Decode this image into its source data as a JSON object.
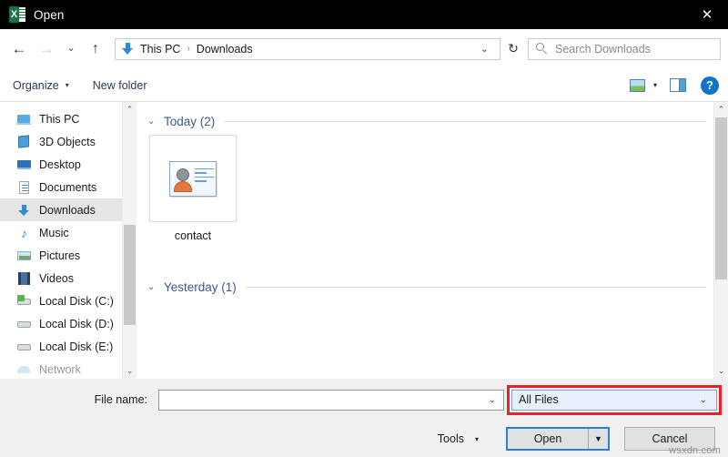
{
  "titlebar": {
    "app_icon": "excel-icon",
    "title": "Open",
    "close_label": "✕"
  },
  "navbar": {
    "back_label": "←",
    "forward_label": "→",
    "recent_label": "⌄",
    "up_label": "↑",
    "breadcrumb": {
      "location_icon": "downloads-arrow-icon",
      "items": [
        "This PC",
        "Downloads"
      ],
      "separator": "›",
      "dropdown_label": "⌄"
    },
    "refresh_label": "↻",
    "search": {
      "icon": "search-icon",
      "placeholder": "Search Downloads",
      "value": ""
    }
  },
  "toolbar": {
    "organize_label": "Organize",
    "organize_caret": "▾",
    "new_folder_label": "New folder",
    "view_icon": "view-layout-icon",
    "view_caret": "▾",
    "preview_pane_icon": "preview-pane-icon",
    "help_label": "?"
  },
  "sidebar": {
    "items": [
      {
        "label": "This PC",
        "icon": "this-pc-icon",
        "selected": false
      },
      {
        "label": "3D Objects",
        "icon": "3d-objects-icon",
        "selected": false
      },
      {
        "label": "Desktop",
        "icon": "desktop-icon",
        "selected": false
      },
      {
        "label": "Documents",
        "icon": "documents-icon",
        "selected": false
      },
      {
        "label": "Downloads",
        "icon": "downloads-icon",
        "selected": true
      },
      {
        "label": "Music",
        "icon": "music-icon",
        "selected": false
      },
      {
        "label": "Pictures",
        "icon": "pictures-icon",
        "selected": false
      },
      {
        "label": "Videos",
        "icon": "videos-icon",
        "selected": false
      },
      {
        "label": "Local Disk (C:)",
        "icon": "local-disk-c-icon",
        "selected": false
      },
      {
        "label": "Local Disk (D:)",
        "icon": "local-disk-d-icon",
        "selected": false
      },
      {
        "label": "Local Disk (E:)",
        "icon": "local-disk-e-icon",
        "selected": false
      },
      {
        "label": "Network",
        "icon": "network-icon",
        "selected": false
      }
    ],
    "scroll_up": "⌃",
    "scroll_down": "⌄"
  },
  "filelist": {
    "groups": [
      {
        "chevron": "⌄",
        "title": "Today (2)",
        "files": [
          {
            "name": "contact",
            "icon": "contact-card-icon"
          }
        ]
      },
      {
        "chevron": "⌄",
        "title": "Yesterday (1)",
        "files": []
      }
    ],
    "scroll_up": "⌃",
    "scroll_down": "⌄"
  },
  "footer": {
    "filename_label": "File name:",
    "filename_value": "",
    "filename_placeholder": "",
    "filename_caret": "⌄",
    "filter_value": "All Files",
    "filter_caret": "⌄",
    "filter_highlight_color": "#e8212a",
    "tools_label": "Tools",
    "tools_caret": "▾",
    "open_label": "Open",
    "open_caret": "▼",
    "cancel_label": "Cancel",
    "watermark": "wsxdn.com"
  }
}
